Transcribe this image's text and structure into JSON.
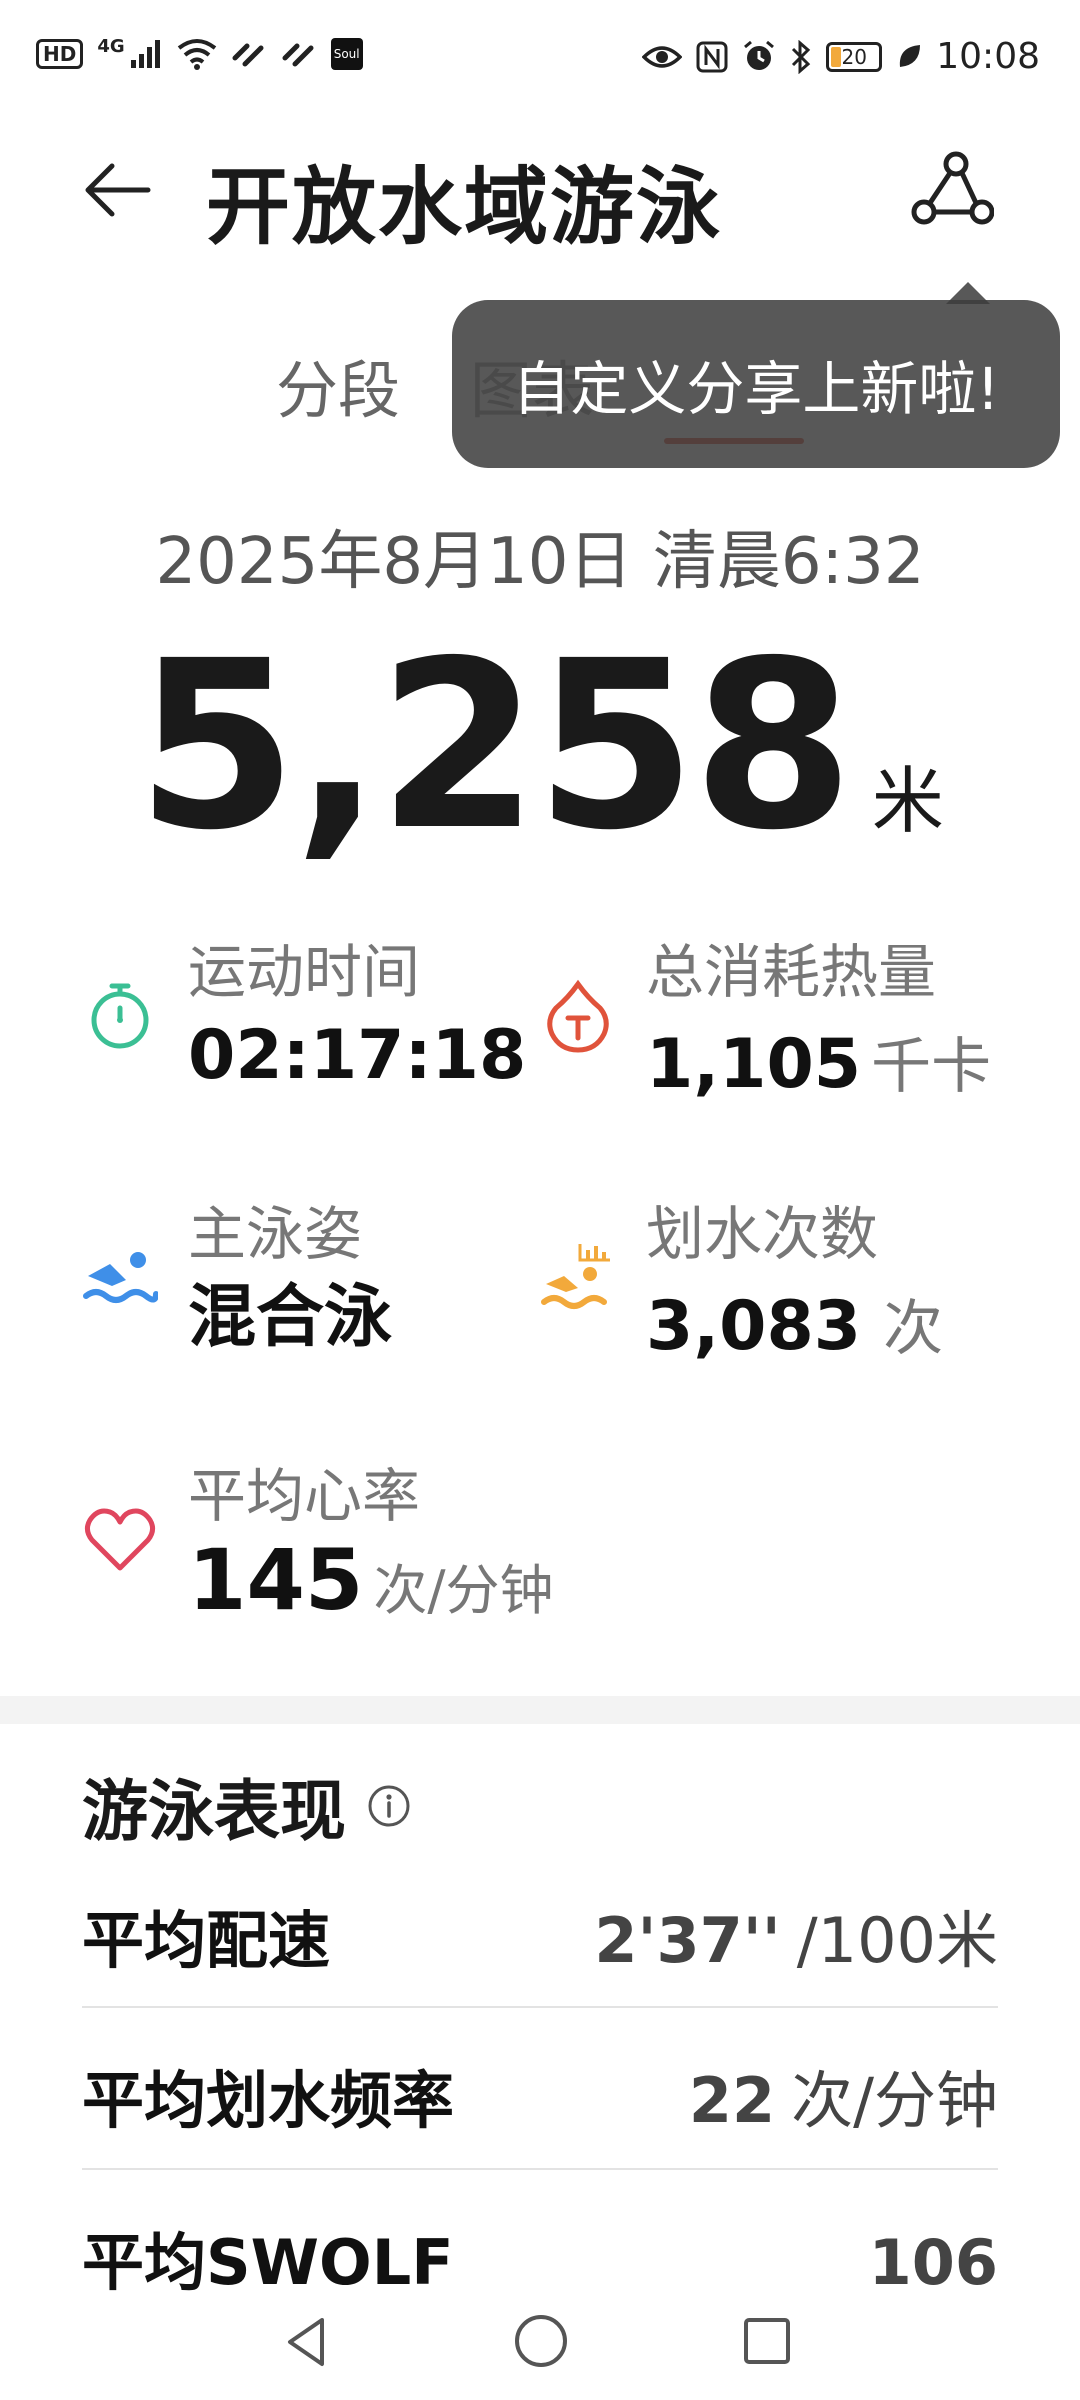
{
  "status_bar": {
    "hd": "HD",
    "network": "4G",
    "soul": "Soul",
    "battery": "20",
    "time": "10:08"
  },
  "header": {
    "title": "开放水域游泳"
  },
  "tabs": {
    "segments_label": "分段",
    "partial_label": "图表"
  },
  "tooltip": {
    "text": "自定义分享上新啦!"
  },
  "workout": {
    "date": "2025年8月10日 清晨6:32",
    "distance": "5,258",
    "distance_unit": "米"
  },
  "stats": [
    {
      "label": "运动时间",
      "value": "02:17:18",
      "unit": "",
      "icon": "stopwatch-icon",
      "color": "#3bbf94"
    },
    {
      "label": "总消耗热量",
      "value": "1,105",
      "unit": "千卡",
      "icon": "calorie-icon",
      "color": "#e0533b"
    },
    {
      "label": "主泳姿",
      "value": "混合泳",
      "unit": "",
      "icon": "swimmer-icon",
      "color": "#3f8fe8"
    },
    {
      "label": "划水次数",
      "value": "3,083",
      "unit": "次",
      "icon": "stroke-count-icon",
      "color": "#f2a93b"
    },
    {
      "label": "平均心率",
      "value": "145",
      "unit": "次/分钟",
      "icon": "heart-icon",
      "color": "#e0465e"
    }
  ],
  "performance": {
    "title": "游泳表现",
    "rows": [
      {
        "label": "平均配速",
        "value": "2'37''",
        "unit": "/100米"
      },
      {
        "label": "平均划水频率",
        "value": "22",
        "unit": "次/分钟"
      },
      {
        "label": "平均SWOLF",
        "value": "106",
        "unit": ""
      }
    ]
  }
}
